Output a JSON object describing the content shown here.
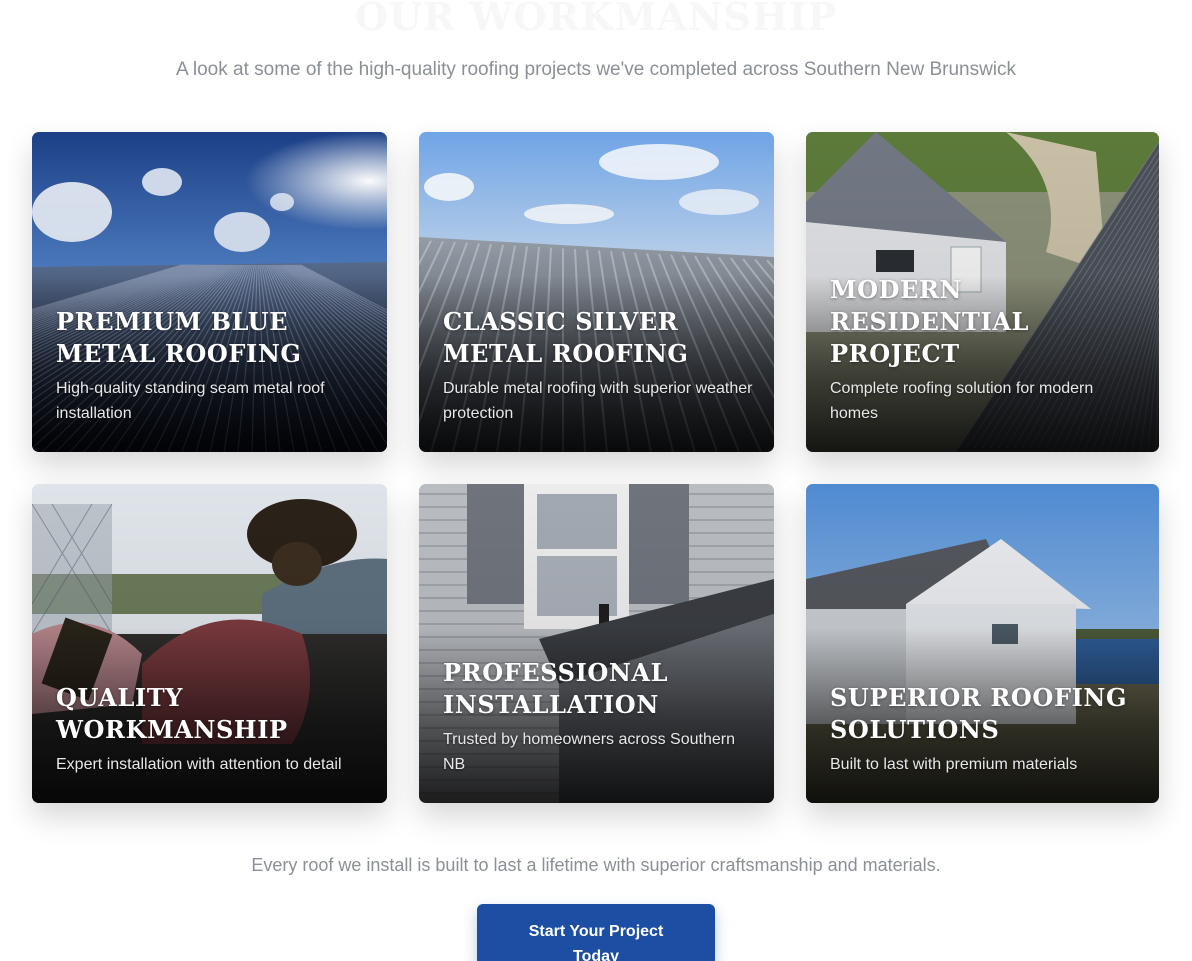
{
  "section": {
    "heading": "OUR WORKMANSHIP",
    "subtitle": "A look at some of the high-quality roofing projects we've completed across Southern New Brunswick",
    "footer_note": "Every roof we install is built to last a lifetime with superior craftsmanship and materials.",
    "cta_label": "Start Your Project Today"
  },
  "projects": [
    {
      "title": "Premium Blue Metal Roofing",
      "description": "High-quality standing seam metal roof installation"
    },
    {
      "title": "Classic Silver Metal Roofing",
      "description": "Durable metal roofing with superior weather protection"
    },
    {
      "title": "Modern Residential Project",
      "description": "Complete roofing solution for modern homes"
    },
    {
      "title": "Quality Workmanship",
      "description": "Expert installation with attention to detail"
    },
    {
      "title": "Professional Installation",
      "description": "Trusted by homeowners across Southern NB"
    },
    {
      "title": "Superior Roofing Solutions",
      "description": "Built to last with premium materials"
    }
  ],
  "colors": {
    "cta": "#1c4fa3",
    "muted_text": "#8b8f98"
  }
}
